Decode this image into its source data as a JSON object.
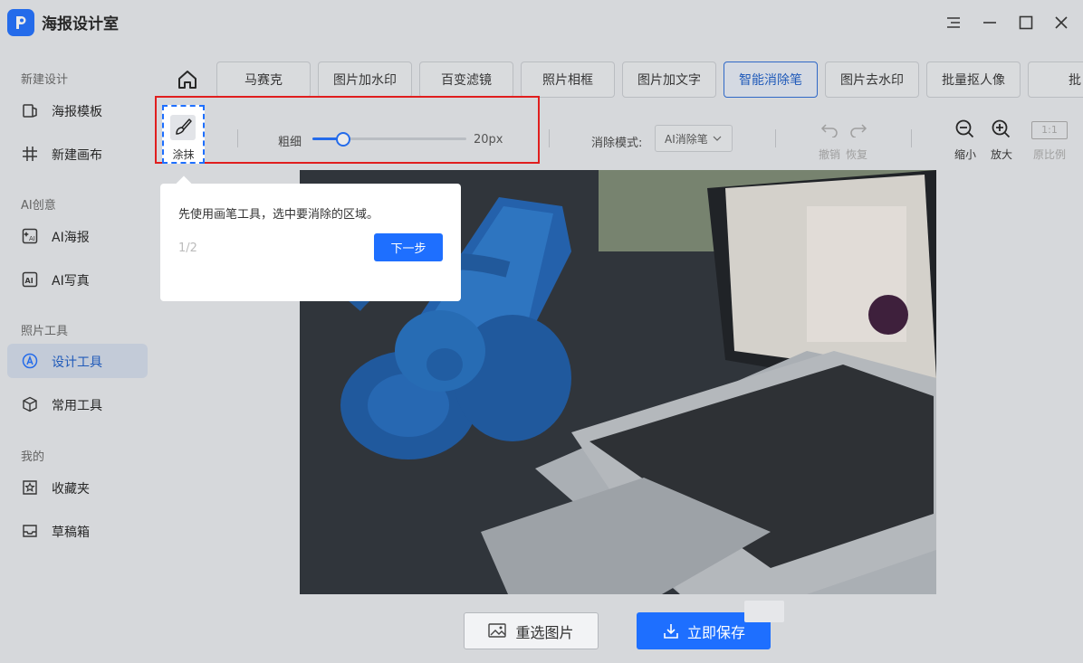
{
  "app": {
    "title": "海报设计室"
  },
  "sidebar": {
    "sections": [
      {
        "title": "新建设计",
        "items": [
          {
            "label": "海报模板",
            "icon": "poster-template-icon"
          },
          {
            "label": "新建画布",
            "icon": "hash-canvas-icon"
          }
        ]
      },
      {
        "title": "AI创意",
        "items": [
          {
            "label": "AI海报",
            "icon": "ai-poster-icon"
          },
          {
            "label": "AI写真",
            "icon": "ai-portrait-icon"
          }
        ]
      },
      {
        "title": "照片工具",
        "items": [
          {
            "label": "设计工具",
            "icon": "compass-icon",
            "active": true
          },
          {
            "label": "常用工具",
            "icon": "cube-icon"
          }
        ]
      },
      {
        "title": "我的",
        "items": [
          {
            "label": "收藏夹",
            "icon": "star-icon"
          },
          {
            "label": "草稿箱",
            "icon": "inbox-icon"
          }
        ]
      }
    ]
  },
  "tabs": [
    {
      "label": "马赛克"
    },
    {
      "label": "图片加水印"
    },
    {
      "label": "百变滤镜"
    },
    {
      "label": "照片相框"
    },
    {
      "label": "图片加文字"
    },
    {
      "label": "智能消除笔",
      "active": true
    },
    {
      "label": "图片去水印"
    },
    {
      "label": "批量抠人像"
    },
    {
      "label": "批"
    }
  ],
  "toolbar": {
    "smear_label": "涂抹",
    "thickness_label": "粗细",
    "thickness_value": "20px",
    "thickness_fraction": 0.2,
    "mode_label": "消除模式:",
    "mode_value": "AI消除笔",
    "undo_label": "撤销",
    "redo_label": "恢复",
    "zoom_out_label": "缩小",
    "zoom_in_label": "放大",
    "ratio_badge": "1:1",
    "ratio_label": "原比例"
  },
  "tooltip": {
    "text": "先使用画笔工具，选中要消除的区域。",
    "step": "1/2",
    "next_label": "下一步"
  },
  "actions": {
    "reselect_label": "重选图片",
    "save_label": "立即保存"
  },
  "colors": {
    "accent": "#1e6fff",
    "highlight_border": "#e01e1e"
  }
}
